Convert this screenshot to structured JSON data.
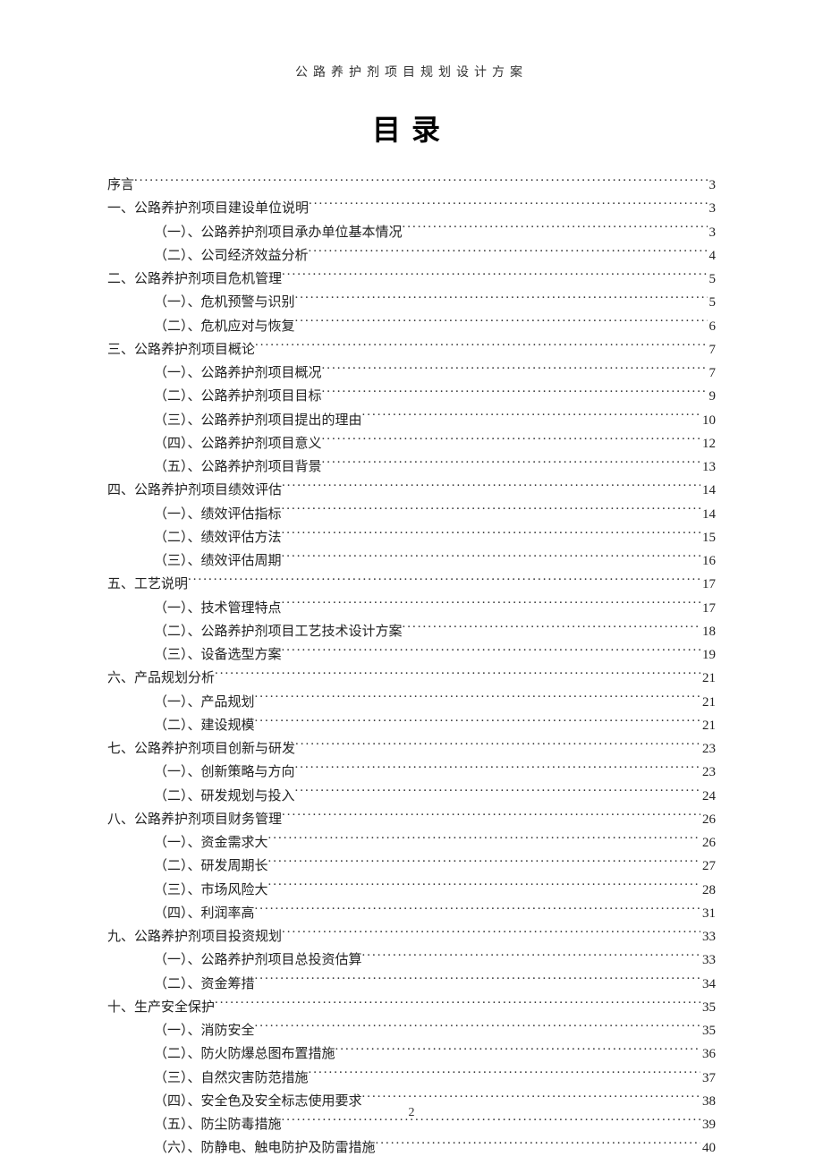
{
  "header": "公路养护剂项目规划设计方案",
  "title": "目录",
  "page_number": "2",
  "toc": [
    {
      "level": 1,
      "label": "序言",
      "page": "3"
    },
    {
      "level": 1,
      "label": "一、公路养护剂项目建设单位说明",
      "page": "3"
    },
    {
      "level": 2,
      "label": "（一）、公路养护剂项目承办单位基本情况",
      "page": "3"
    },
    {
      "level": 2,
      "label": "（二）、公司经济效益分析",
      "page": "4"
    },
    {
      "level": 1,
      "label": "二、公路养护剂项目危机管理",
      "page": "5"
    },
    {
      "level": 2,
      "label": "（一）、危机预警与识别",
      "page": "5"
    },
    {
      "level": 2,
      "label": "（二）、危机应对与恢复",
      "page": "6"
    },
    {
      "level": 1,
      "label": "三、公路养护剂项目概论",
      "page": "7"
    },
    {
      "level": 2,
      "label": "（一）、公路养护剂项目概况",
      "page": "7"
    },
    {
      "level": 2,
      "label": "（二）、公路养护剂项目目标",
      "page": "9"
    },
    {
      "level": 2,
      "label": "（三）、公路养护剂项目提出的理由",
      "page": "10"
    },
    {
      "level": 2,
      "label": "（四）、公路养护剂项目意义",
      "page": "12"
    },
    {
      "level": 2,
      "label": "（五）、公路养护剂项目背景",
      "page": "13"
    },
    {
      "level": 1,
      "label": "四、公路养护剂项目绩效评估",
      "page": "14"
    },
    {
      "level": 2,
      "label": "（一）、绩效评估指标",
      "page": "14"
    },
    {
      "level": 2,
      "label": "（二）、绩效评估方法",
      "page": "15"
    },
    {
      "level": 2,
      "label": "（三）、绩效评估周期",
      "page": "16"
    },
    {
      "level": 1,
      "label": "五、工艺说明",
      "page": "17"
    },
    {
      "level": 2,
      "label": "（一）、技术管理特点",
      "page": "17"
    },
    {
      "level": 2,
      "label": "（二）、公路养护剂项目工艺技术设计方案",
      "page": "18"
    },
    {
      "level": 2,
      "label": "（三）、设备选型方案",
      "page": "19"
    },
    {
      "level": 1,
      "label": "六、产品规划分析",
      "page": "21"
    },
    {
      "level": 2,
      "label": "（一）、产品规划",
      "page": "21"
    },
    {
      "level": 2,
      "label": "（二）、建设规模",
      "page": "21"
    },
    {
      "level": 1,
      "label": "七、公路养护剂项目创新与研发",
      "page": "23"
    },
    {
      "level": 2,
      "label": "（一）、创新策略与方向",
      "page": "23"
    },
    {
      "level": 2,
      "label": "（二）、研发规划与投入",
      "page": "24"
    },
    {
      "level": 1,
      "label": "八、公路养护剂项目财务管理",
      "page": "26"
    },
    {
      "level": 2,
      "label": "（一）、资金需求大",
      "page": "26"
    },
    {
      "level": 2,
      "label": "（二）、研发周期长",
      "page": "27"
    },
    {
      "level": 2,
      "label": "（三）、市场风险大",
      "page": "28"
    },
    {
      "level": 2,
      "label": "（四）、利润率高",
      "page": "31"
    },
    {
      "level": 1,
      "label": "九、公路养护剂项目投资规划",
      "page": "33"
    },
    {
      "level": 2,
      "label": "（一）、公路养护剂项目总投资估算",
      "page": "33"
    },
    {
      "level": 2,
      "label": "（二）、资金筹措",
      "page": "34"
    },
    {
      "level": 1,
      "label": "十、生产安全保护",
      "page": "35"
    },
    {
      "level": 2,
      "label": "（一）、消防安全",
      "page": "35"
    },
    {
      "level": 2,
      "label": "（二）、防火防爆总图布置措施",
      "page": "36"
    },
    {
      "level": 2,
      "label": "（三）、自然灾害防范措施",
      "page": "37"
    },
    {
      "level": 2,
      "label": "（四）、安全色及安全标志使用要求",
      "page": "38"
    },
    {
      "level": 2,
      "label": "（五）、防尘防毒措施",
      "page": "39"
    },
    {
      "level": 2,
      "label": "（六）、防静电、触电防护及防雷措施",
      "page": "40"
    }
  ]
}
